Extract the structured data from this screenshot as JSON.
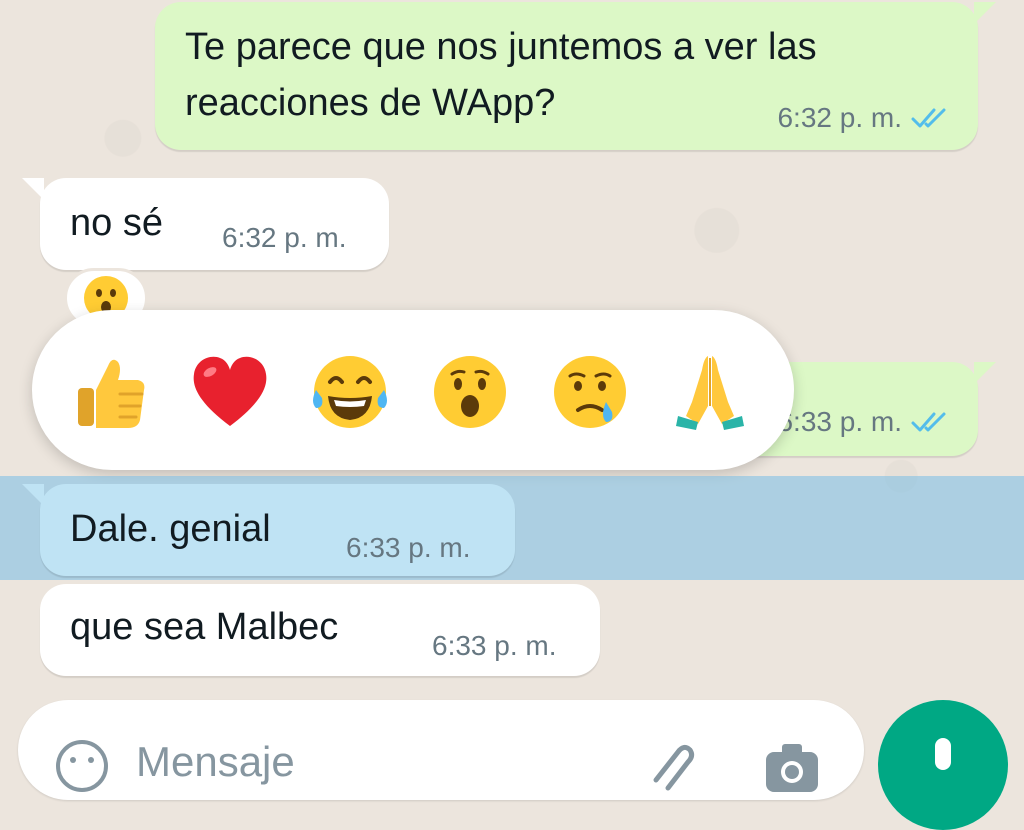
{
  "chat": {
    "messages": [
      {
        "text_line1": "Te parece que nos juntemos a ver las",
        "text_line2": "reacciones de WApp?",
        "time": "6:32 p. m.",
        "status": "read"
      },
      {
        "text": "no sé",
        "time": "6:32 p. m."
      },
      {
        "time": "6:33 p. m.",
        "status": "read"
      },
      {
        "text": "Dale. genial",
        "time": "6:33 p. m."
      },
      {
        "text": "que sea Malbec",
        "time": "6:33 p. m."
      }
    ],
    "existing_reaction": "astonished-face"
  },
  "reaction_picker": {
    "options": [
      "thumbs-up",
      "red-heart",
      "tears-of-joy",
      "astonished-face",
      "crying-face",
      "folded-hands"
    ]
  },
  "composer": {
    "placeholder": "Mensaje"
  },
  "colors": {
    "outgoing_bubble": "#dcf8c6",
    "incoming_bubble": "#ffffff",
    "selection_highlight": "#78bee6",
    "read_ticks": "#53bdeb",
    "mic_button": "#00a884"
  }
}
